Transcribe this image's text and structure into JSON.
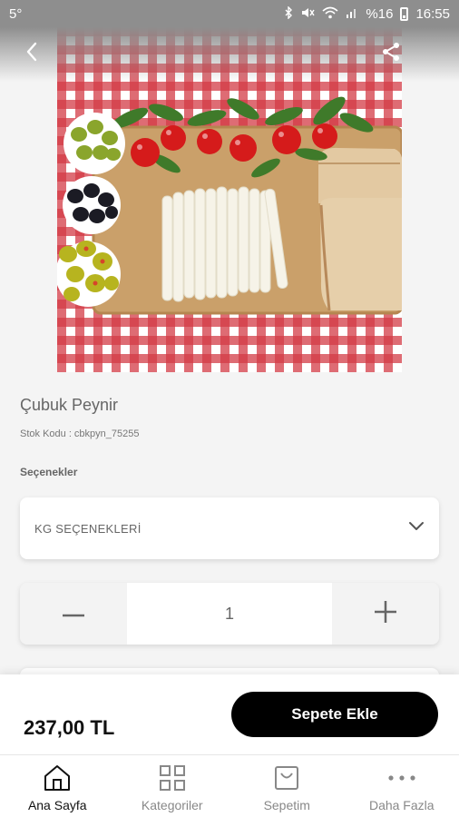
{
  "status_bar": {
    "temperature": "5°",
    "battery_percent": "%16",
    "time": "16:55"
  },
  "product": {
    "title": "Çubuk Peynir",
    "stock_code": "Stok Kodu : cbkpyn_75255",
    "options_label": "Seçenekler",
    "options_selected": "KG SEÇENEKLERİ",
    "quantity": "1",
    "price": "237,00 TL"
  },
  "actions": {
    "add_to_cart": "Sepete Ekle"
  },
  "nav": {
    "items": [
      {
        "label": "Ana Sayfa",
        "icon": "home-icon",
        "active": true
      },
      {
        "label": "Kategoriler",
        "icon": "grid-icon",
        "active": false
      },
      {
        "label": "Sepetim",
        "icon": "cart-icon",
        "active": false
      },
      {
        "label": "Daha Fazla",
        "icon": "more-icon",
        "active": false
      }
    ]
  },
  "colors": {
    "status_bar": "#8e8e8e",
    "button": "#000000",
    "background": "#f4f4f4"
  }
}
